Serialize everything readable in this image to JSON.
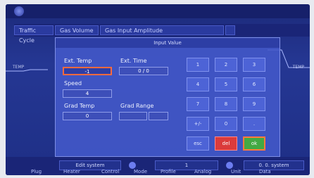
{
  "tabs": [
    "Traffic Cycle",
    "Gas Volume",
    "Gas Input Amplitude",
    ""
  ],
  "dialog": {
    "title": "Input Value",
    "labels": {
      "ext_temp": "Ext. Temp",
      "ext_time": "Ext. Time",
      "speed": "Speed",
      "grad_temp": "Grad Temp",
      "grad_range": "Grad Range"
    },
    "values": {
      "ext_temp": "-1",
      "ext_time": "0 / 0",
      "speed": "4",
      "grad_temp": "0",
      "grad_range_min": "",
      "grad_range_max": ""
    },
    "keypad": [
      "1",
      "2",
      "3",
      "4",
      "5",
      "6",
      "7",
      "8",
      "9",
      "+/-",
      "0",
      ".",
      "esc",
      "del",
      "ok"
    ]
  },
  "side_labels": {
    "left": "TEMP",
    "right": "TEMP"
  },
  "bottom": {
    "left_btn": "Edit system",
    "mid_btn": "1",
    "right_btn": "0. 0. system",
    "items": [
      "Plug",
      "Heater",
      "Control",
      "Mode",
      "Profile",
      "Analog",
      "Unit",
      "Data"
    ]
  },
  "colors": {
    "accent": "#ff6a3d",
    "ok": "#43a943",
    "del": "#db3b3b"
  }
}
